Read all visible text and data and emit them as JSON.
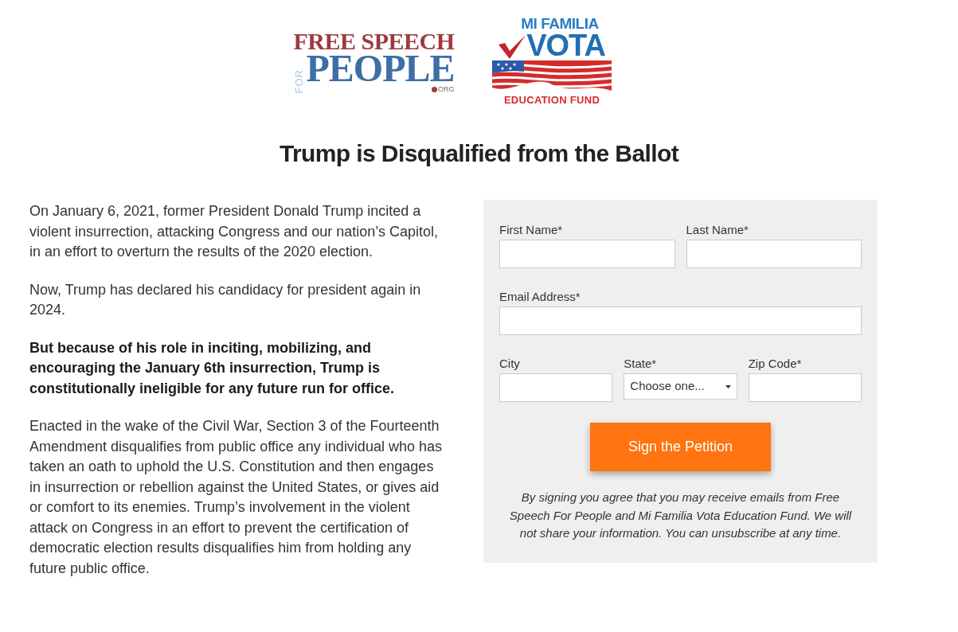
{
  "logos": [
    {
      "kind": "fsfp",
      "line_1": "FREE SPEECH",
      "side": "FOR",
      "line_2": "PEOPLE",
      "suffix": "ORG"
    },
    {
      "kind": "mfv",
      "line_1": "MI FAMILIA",
      "line_2": "VOTA",
      "line_3": "EDUCATION FUND"
    }
  ],
  "title": "Trump is Disqualified from the Ballot",
  "paragraphs": [
    {
      "text": "On January 6, 2021, former President Donald Trump incited a violent insurrection, attacking Congress and our nation’s Capitol, in an effort to overturn the results of the 2020 election.",
      "bold": false
    },
    {
      "text": "Now, Trump has declared his candidacy for president again in 2024.",
      "bold": false
    },
    {
      "text": "But because of his role in inciting, mobilizing, and encouraging the January 6th insurrection, Trump is constitutionally ineligible for any future run for office.",
      "bold": true
    },
    {
      "text": "Enacted in the wake of the Civil War, Section 3 of the Fourteenth Amendment disqualifies from public office any individual who has taken an oath to uphold the U.S. Constitution and then engages in insurrection or rebellion against the United States, or gives aid or comfort to its enemies. Trump’s involvement in the violent attack on Congress in an effort to prevent the certification of democratic election results disqualifies him from holding any future public office.",
      "bold": false
    }
  ],
  "form": {
    "rows": [
      [
        {
          "label": "First Name*",
          "kind": "text"
        },
        {
          "label": "Last Name*",
          "kind": "text"
        }
      ],
      [
        {
          "label": "Email Address*",
          "kind": "text"
        }
      ],
      [
        {
          "label": "City",
          "kind": "text"
        },
        {
          "label": "State*",
          "kind": "select",
          "value": "Choose one..."
        },
        {
          "label": "Zip Code*",
          "kind": "text"
        }
      ]
    ],
    "submit": "Sign the Petition",
    "disclaimer": "By signing you agree that you may receive emails from Free Speech For People and Mi Familia Vota Education Fund. We will not share your information. You can unsubscribe at any time."
  }
}
